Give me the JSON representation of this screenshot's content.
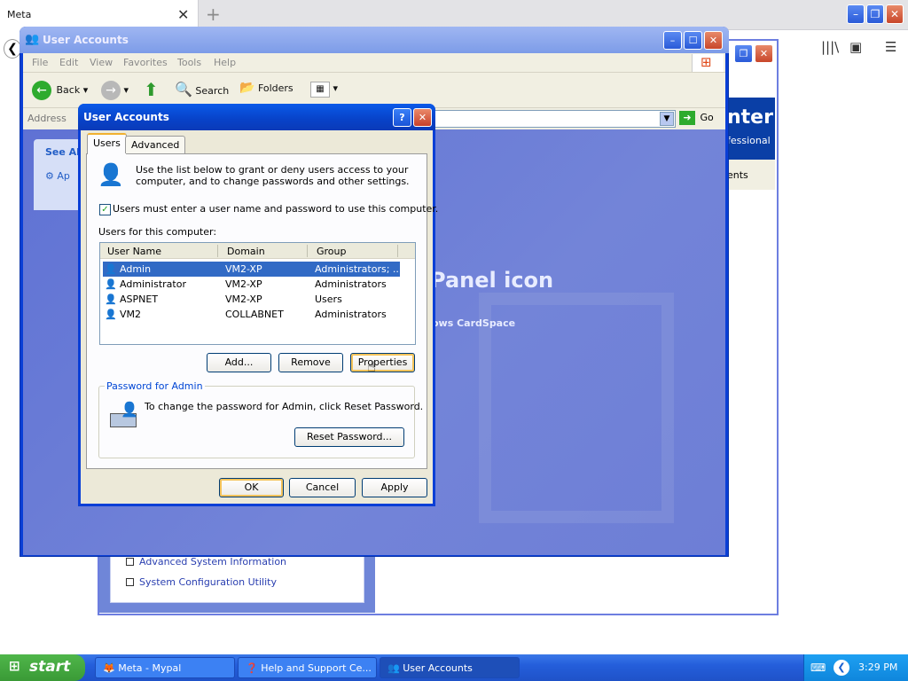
{
  "browser": {
    "tab_title": "Meta",
    "tab_close": "✕",
    "new_tab": "+",
    "controls": {
      "minimize": "–",
      "restore": "❐",
      "close": "✕"
    }
  },
  "help_window": {
    "header_title": "nter",
    "header_subtitle": "fessional",
    "band_text": "ents",
    "links": [
      "Advanced System Information",
      "System Configuration Utility"
    ]
  },
  "control_panel": {
    "title": "User Accounts",
    "menu": [
      "File",
      "Edit",
      "View",
      "Favorites",
      "Tools",
      "Help"
    ],
    "toolbar": {
      "back": "Back",
      "search": "Search",
      "folders": "Folders"
    },
    "address_label": "Address",
    "go_label": "Go",
    "see_also": "See Als",
    "see_also_item": "Ap",
    "body_heading": "Panel icon",
    "body_link": "ows CardSpace"
  },
  "dialog": {
    "title": "User Accounts",
    "help_btn": "?",
    "close_btn": "✕",
    "tabs": [
      "Users",
      "Advanced"
    ],
    "intro_text_1": "Use the list below to grant or deny users access to your",
    "intro_text_2": "computer, and to change passwords and other settings.",
    "must_login_label": "Users must enter a user name and password to use this computer.",
    "must_login_checked": "✓",
    "users_label": "Users for this computer:",
    "columns": [
      "User Name",
      "Domain",
      "Group"
    ],
    "users": [
      {
        "name": "Admin",
        "domain": "VM2-XP",
        "group": "Administrators; ..."
      },
      {
        "name": "Administrator",
        "domain": "VM2-XP",
        "group": "Administrators"
      },
      {
        "name": "ASPNET",
        "domain": "VM2-XP",
        "group": "Users"
      },
      {
        "name": "VM2",
        "domain": "COLLABNET",
        "group": "Administrators"
      }
    ],
    "buttons": {
      "add": "Add...",
      "remove": "Remove",
      "properties": "Properties"
    },
    "password_group_label": "Password for Admin",
    "password_text": "To change the password for Admin, click Reset Password.",
    "reset_password": "Reset Password...",
    "ok": "OK",
    "cancel": "Cancel",
    "apply": "Apply"
  },
  "taskbar": {
    "start": "start",
    "tasks": [
      "Meta - Mypal",
      "Help and Support Ce...",
      "User Accounts"
    ],
    "clock": "3:29 PM"
  }
}
